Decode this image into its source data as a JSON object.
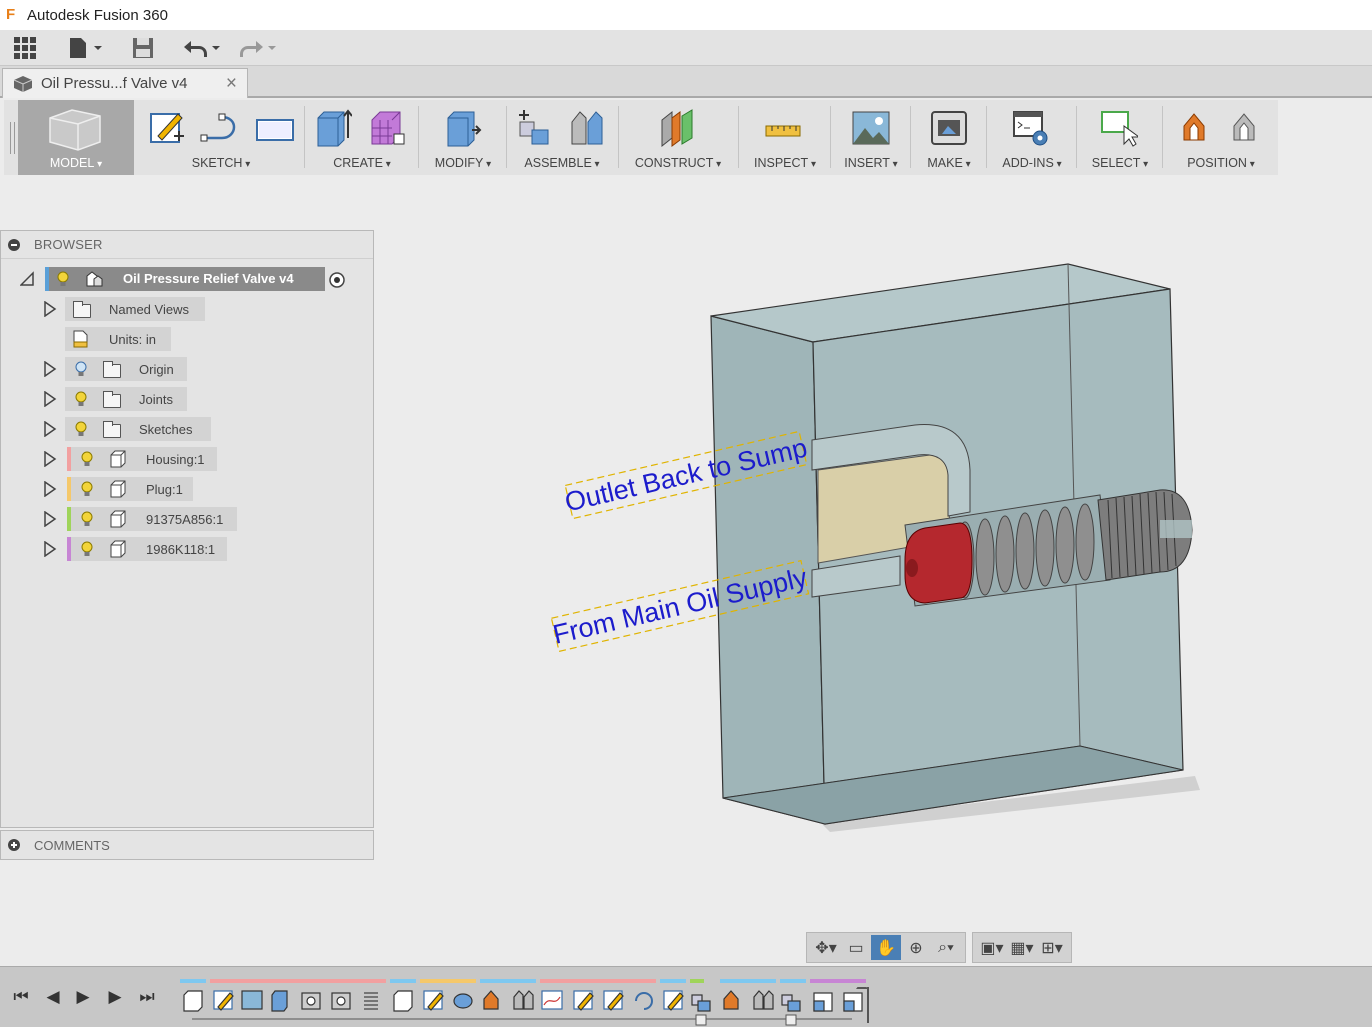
{
  "app": {
    "title": "Autodesk Fusion 360"
  },
  "document_tab": {
    "title": "Oil Pressu...f Valve v4",
    "close": "×"
  },
  "toolbar": {
    "groups": [
      {
        "label": "MODEL"
      },
      {
        "label": "SKETCH"
      },
      {
        "label": "CREATE"
      },
      {
        "label": "MODIFY"
      },
      {
        "label": "ASSEMBLE"
      },
      {
        "label": "CONSTRUCT"
      },
      {
        "label": "INSPECT"
      },
      {
        "label": "INSERT"
      },
      {
        "label": "MAKE"
      },
      {
        "label": "ADD-INS"
      },
      {
        "label": "SELECT"
      },
      {
        "label": "POSITION"
      }
    ]
  },
  "browser": {
    "title": "BROWSER",
    "root": "Oil Pressure Relief Valve v4",
    "items": [
      {
        "label": "Named Views"
      },
      {
        "label": "Units: in"
      },
      {
        "label": "Origin"
      },
      {
        "label": "Joints"
      },
      {
        "label": "Sketches"
      },
      {
        "label": "Housing:1",
        "color": "#f2a0a0"
      },
      {
        "label": "Plug:1",
        "color": "#f5c86a"
      },
      {
        "label": "91375A856:1",
        "color": "#9fd45a"
      },
      {
        "label": "1986K118:1",
        "color": "#c785d4"
      }
    ]
  },
  "comments": {
    "title": "COMMENTS"
  },
  "viewport": {
    "annotations": [
      {
        "text": "Outlet Back to Sump"
      },
      {
        "text": "From Main Oil Supply"
      }
    ]
  },
  "colors": {
    "housing": "#a9bdc0",
    "plug": "#b5282e",
    "annotation_text": "#1c1ccc",
    "annotation_box": "#e0b400",
    "accent": "#4a7fb5"
  }
}
